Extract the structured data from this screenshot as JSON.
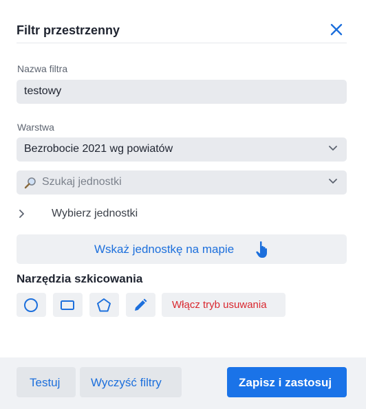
{
  "dialog": {
    "title": "Filtr przestrzenny",
    "close_icon": "close-icon"
  },
  "filter_name": {
    "label": "Nazwa filtra",
    "value": "testowy"
  },
  "layer": {
    "label": "Warstwa",
    "selected": "Bezrobocie 2021 wg powiatów"
  },
  "unit_search": {
    "placeholder": "Szukaj jednostki",
    "icon": "search-icon"
  },
  "select_units": {
    "label": "Wybierz jednostki"
  },
  "map_button": {
    "label": "Wskaż jednostkę na mapie",
    "icon": "hand-pointer-icon"
  },
  "tools": {
    "title": "Narzędzia szkicowania",
    "items": [
      "circle-icon",
      "rectangle-icon",
      "polygon-icon",
      "pencil-icon"
    ],
    "delete_mode_label": "Włącz tryb usuwania"
  },
  "footer": {
    "test_label": "Testuj",
    "clear_label": "Wyczyść filtry",
    "save_label": "Zapisz i zastosuj"
  },
  "colors": {
    "accent": "#1a73e8",
    "link": "#1c6fdc",
    "danger": "#d9272e",
    "field_bg": "#e8eaee"
  }
}
